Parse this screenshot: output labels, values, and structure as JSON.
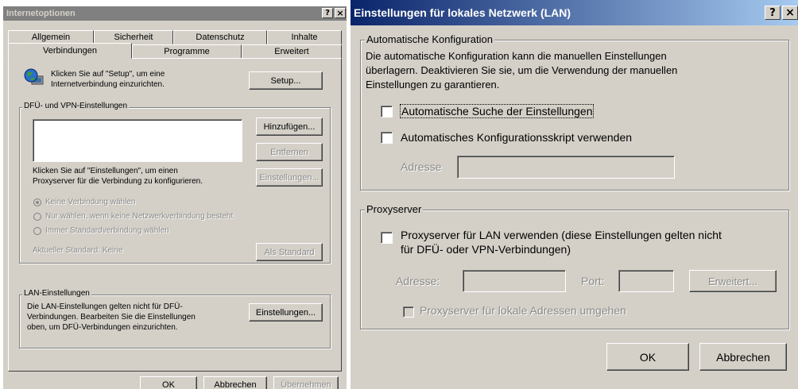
{
  "colors": {
    "face": "#d4d0c8",
    "title_left_active": "#0a246a",
    "title_right_active": "#a6caf0",
    "title_inactive": "#808080"
  },
  "left": {
    "title": "Internetoptionen",
    "help_btn": "?",
    "close_btn": "×",
    "tabs_row1": [
      "Allgemein",
      "Sicherheit",
      "Datenschutz",
      "Inhalte"
    ],
    "tabs_row2": [
      "Verbindungen",
      "Programme",
      "Erweitert"
    ],
    "setup_text_1": "Klicken Sie auf \"Setup\", um eine",
    "setup_text_2": "Internetverbindung einzurichten.",
    "setup_btn": "Setup...",
    "dfu_label": "DFÜ- und VPN-Einstellungen",
    "add_btn": "Hinzufügen...",
    "remove_btn": "Entfernen",
    "settings_btn": "Einstellungen...",
    "proxy_text_1": "Klicken Sie auf \"Einstellungen\", um einen",
    "proxy_text_2": "Proxyserver für die Verbindung zu konfigurieren.",
    "radio_1": "Keine Verbindung wählen",
    "radio_2": "Nur wählen, wenn keine Netzwerkverbindung besteht",
    "radio_3": "Immer Standardverbindung wählen",
    "current_default": "Aktueller Standard:   Keine",
    "default_btn": "Als Standard",
    "lan_label": "LAN-Einstellungen",
    "lan_text_1": "Die LAN-Einstellungen gelten nicht für DFÜ-",
    "lan_text_2": "Verbindungen. Bearbeiten Sie die Einstellungen",
    "lan_text_3": "oben, um DFÜ-Verbindungen einzurichten.",
    "lan_btn": "Einstellungen...",
    "ok_btn": "OK",
    "cancel_btn": "Abbrechen",
    "apply_btn": "Übernehmen"
  },
  "right": {
    "title": "Einstellungen für lokales Netzwerk (LAN)",
    "help_btn": "?",
    "close_btn": "×",
    "auto_label": "Automatische Konfiguration",
    "auto_desc_1": "Die automatische Konfiguration kann die manuellen Einstellungen",
    "auto_desc_2": "überlagern. Deaktivieren Sie sie, um die Verwendung der manuellen",
    "auto_desc_3": "Einstellungen zu garantieren.",
    "chk_auto_detect": "Automatische Suche der Einstellungen",
    "chk_script": "Automatisches Konfigurationsskript verwenden",
    "address_label": "Adresse",
    "proxy_label": "Proxyserver",
    "chk_proxy_1": "Proxyserver für LAN verwenden (diese Einstellungen gelten nicht",
    "chk_proxy_2": "für DFÜ- oder VPN-Verbindungen)",
    "proxy_address_label": "Adresse:",
    "port_label": "Port:",
    "advanced_btn": "Erweitert...",
    "chk_bypass": "Proxyserver für lokale Adressen umgehen",
    "ok_btn": "OK",
    "cancel_btn": "Abbrechen"
  }
}
